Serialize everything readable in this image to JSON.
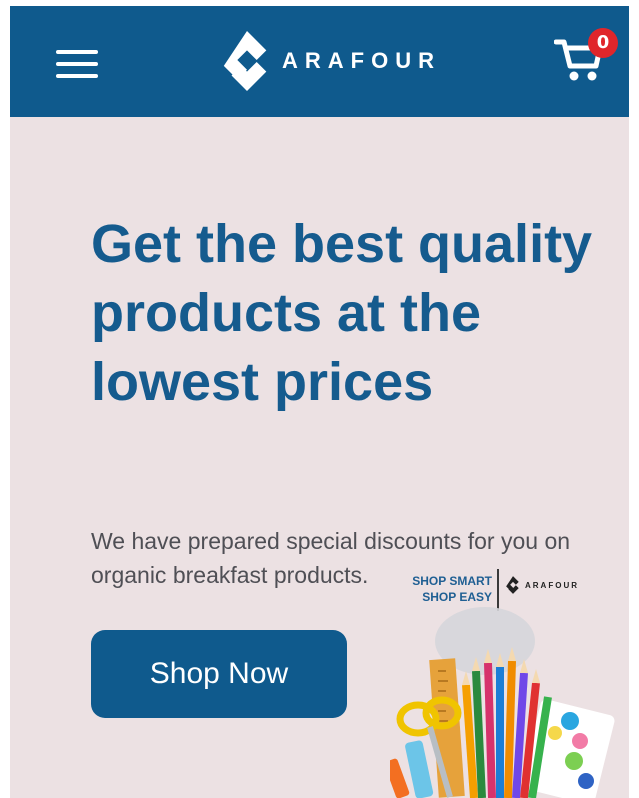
{
  "header": {
    "brand_name": "ARAFOUR",
    "cart_count": "0",
    "brand_color": "#0f5a8d",
    "badge_color": "#e0262b",
    "menu_icon": "hamburger-menu-icon",
    "cart_icon": "shopping-cart-icon"
  },
  "hero": {
    "headline": "Get the best quality products at the lowest prices",
    "subtext": "We have prepared special discounts for you on organic breakfast products.",
    "cta_label": "Shop Now",
    "background_color": "#ece1e3",
    "headline_color": "#155b8e"
  },
  "promo": {
    "tagline_1": "SHOP SMART",
    "tagline_2": "SHOP EASY",
    "brand_name": "ARAFOUR",
    "art_icon": "stationery-pencils-scissors-illustration"
  }
}
